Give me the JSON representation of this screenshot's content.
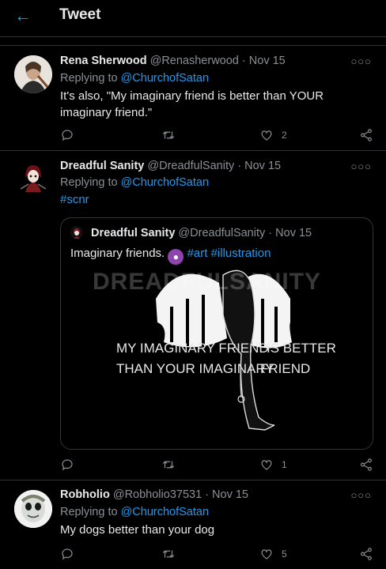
{
  "header": {
    "title": "Tweet"
  },
  "tweets": [
    {
      "name": "Rena Sherwood",
      "handle": "@Renasherwood",
      "date": "Nov 15",
      "replying_prefix": "Replying to",
      "replying_to": "@ChurchofSatan",
      "text": "It's also, \"My imaginary friend is better than YOUR imaginary friend.\"",
      "likes": "2"
    },
    {
      "name": "Dreadful Sanity",
      "handle": "@DreadfulSanity",
      "date": "Nov 15",
      "replying_prefix": "Replying to",
      "replying_to": "@ChurchofSatan",
      "hashtag": "#scnr",
      "likes": "1",
      "quote": {
        "name": "Dreadful Sanity",
        "handle": "@DreadfulSanity",
        "date": "Nov 15",
        "text": "Imaginary friends.",
        "tags": "#art #illustration",
        "watermark": "DREADFULSANITY",
        "art_line1_left": "MY IMAGINARY FRIEND",
        "art_line1_right": "IS BETTER",
        "art_line2_left": "THAN YOUR IMAGINARY",
        "art_line2_right": "FRIEND"
      }
    },
    {
      "name": "Robholio",
      "handle": "@Robholio37531",
      "date": "Nov 15",
      "replying_prefix": "Replying to",
      "replying_to": "@ChurchofSatan",
      "text": "My dogs better than your dog",
      "likes": "5"
    }
  ],
  "separator": "·",
  "icons": [
    "back-arrow-icon",
    "more-icon",
    "reply-icon",
    "retweet-icon",
    "heart-icon",
    "share-icon",
    "devil-emoji"
  ],
  "colors": {
    "accent": "#1d9bf0",
    "background": "#000000",
    "muted": "#8b8f94"
  }
}
